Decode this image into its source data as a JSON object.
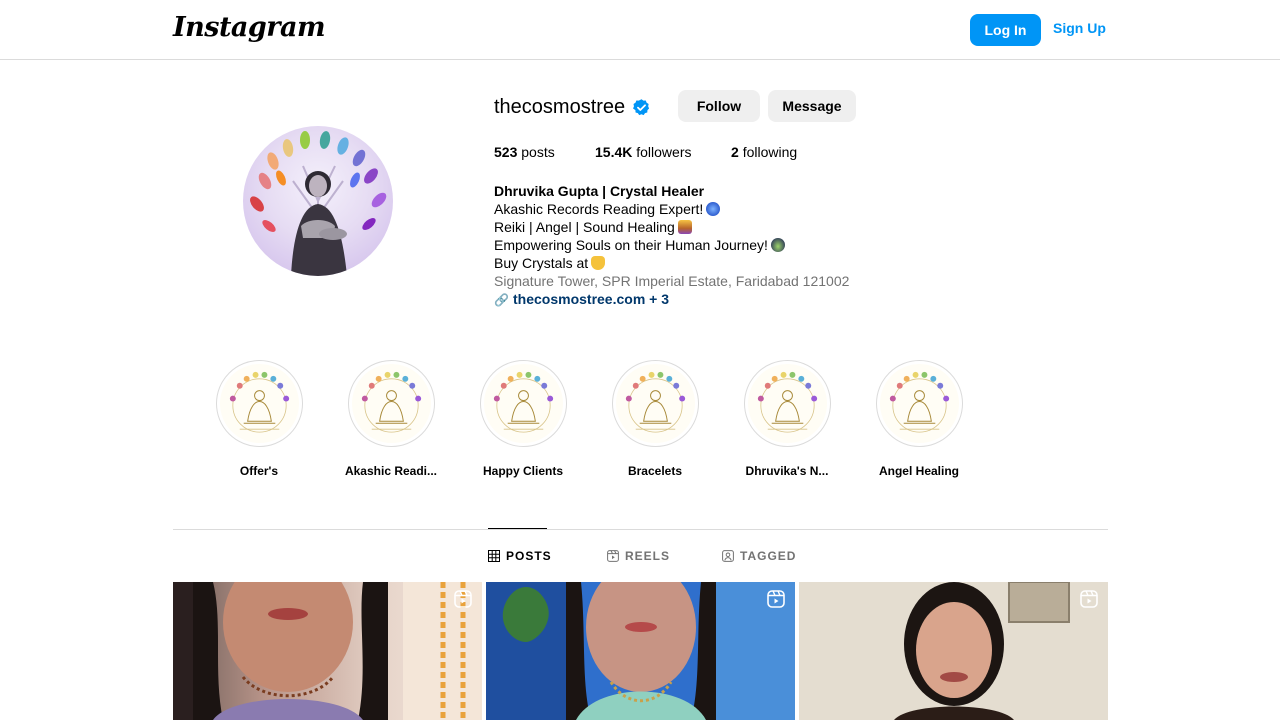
{
  "nav": {
    "logo": "Instagram",
    "login_label": "Log In",
    "signup_label": "Sign Up",
    "accent_color": "#0095f6"
  },
  "profile": {
    "username": "thecosmostree",
    "verified": true,
    "follow_label": "Follow",
    "message_label": "Message",
    "stats": {
      "posts_count": "523",
      "posts_label": "posts",
      "followers_count": "15.4K",
      "followers_label": "followers",
      "following_count": "2",
      "following_label": "following"
    },
    "bio": {
      "name": "Dhruvika Gupta | Crystal Healer",
      "lines": [
        "Akashic Records Reading Expert!",
        "Reiki | Angel | Sound Healing",
        "Empowering Souls on their Human Journey!",
        "Buy Crystals at"
      ],
      "address": "Signature Tower, SPR Imperial Estate, Faridabad 121002",
      "link": "thecosmostree.com + 3"
    }
  },
  "highlights": [
    {
      "label": "Offer's"
    },
    {
      "label": "Akashic Readi..."
    },
    {
      "label": "Happy Clients"
    },
    {
      "label": "Bracelets"
    },
    {
      "label": "Dhruvika's N..."
    },
    {
      "label": "Angel Healing"
    }
  ],
  "tabs": [
    {
      "label": "POSTS",
      "icon": "grid-icon",
      "active": true
    },
    {
      "label": "REELS",
      "icon": "reels-icon",
      "active": false
    },
    {
      "label": "TAGGED",
      "icon": "tagged-icon",
      "active": false
    }
  ],
  "posts": [
    {
      "type": "reel",
      "icon": "reel-icon"
    },
    {
      "type": "reel",
      "icon": "reel-icon"
    },
    {
      "type": "reel",
      "icon": "reel-icon"
    }
  ]
}
